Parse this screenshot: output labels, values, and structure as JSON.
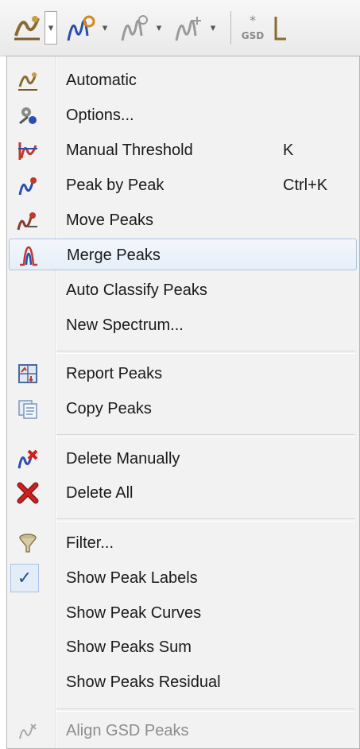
{
  "toolbar": {
    "buttons": [
      {
        "icon": "auto-peak-icon",
        "has_dropdown": true
      },
      {
        "icon": "peak-settings-icon",
        "has_dropdown": true
      },
      {
        "icon": "peak-threshold-gray-icon",
        "has_dropdown": true
      },
      {
        "icon": "peak-sum-gray-icon",
        "has_dropdown": true
      },
      {
        "icon": "gsd-icon",
        "has_dropdown": false,
        "label": "GSD"
      }
    ]
  },
  "menu": {
    "items": [
      {
        "label": "Automatic",
        "shortcut": "",
        "icon": "auto-peak-icon"
      },
      {
        "label": "Options...",
        "shortcut": "",
        "icon": "options-icon"
      },
      {
        "label": "Manual Threshold",
        "shortcut": "K",
        "icon": "manual-threshold-icon"
      },
      {
        "label": "Peak by Peak",
        "shortcut": "Ctrl+K",
        "icon": "peak-by-peak-icon"
      },
      {
        "label": "Move Peaks",
        "shortcut": "",
        "icon": "move-peaks-icon"
      },
      {
        "label": "Merge Peaks",
        "shortcut": "",
        "icon": "merge-peaks-icon",
        "highlighted": true
      },
      {
        "label": "Auto Classify Peaks",
        "shortcut": "",
        "icon": ""
      },
      {
        "label": "New Spectrum...",
        "shortcut": "",
        "icon": ""
      },
      {
        "label": "Report Peaks",
        "shortcut": "",
        "icon": "report-peaks-icon"
      },
      {
        "label": "Copy Peaks",
        "shortcut": "",
        "icon": "copy-peaks-icon"
      },
      {
        "label": "Delete Manually",
        "shortcut": "",
        "icon": "delete-manually-icon"
      },
      {
        "label": "Delete All",
        "shortcut": "",
        "icon": "delete-all-icon"
      },
      {
        "label": "Filter...",
        "shortcut": "",
        "icon": "filter-icon"
      },
      {
        "label": "Show Peak Labels",
        "shortcut": "",
        "icon": "checkmark-icon",
        "checked": true
      },
      {
        "label": "Show Peak Curves",
        "shortcut": "",
        "icon": ""
      },
      {
        "label": "Show Peaks Sum",
        "shortcut": "",
        "icon": ""
      },
      {
        "label": "Show Peaks Residual",
        "shortcut": "",
        "icon": ""
      },
      {
        "label": "Align GSD Peaks",
        "shortcut": "",
        "icon": "align-gsd-icon",
        "disabled": true
      }
    ]
  },
  "colors": {
    "highlight_border": "#aac4e6",
    "highlight_fill": "#e6eef8",
    "disabled_text": "#8d8d8d",
    "peak_red": "#c0392b",
    "peak_blue": "#2a4db0"
  }
}
